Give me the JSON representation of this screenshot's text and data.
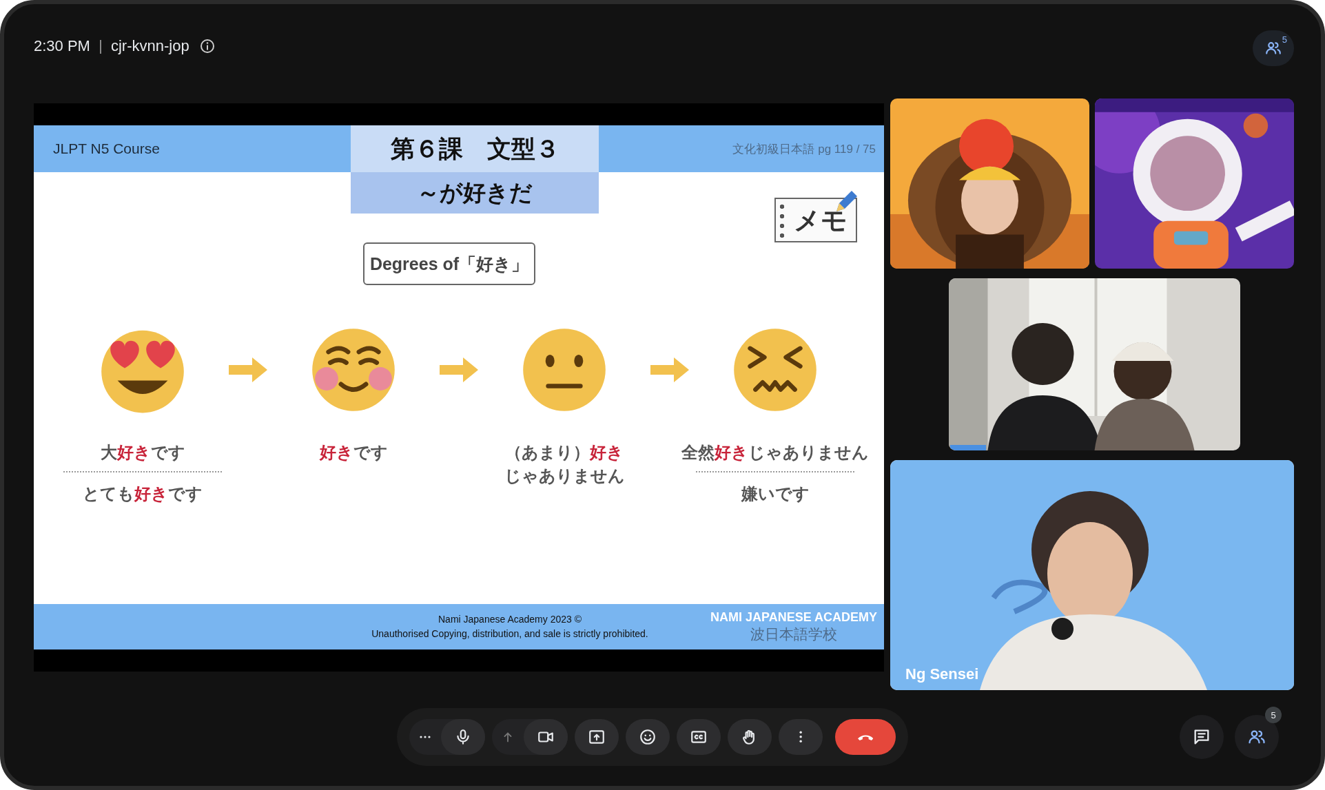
{
  "top_bar": {
    "time": "2:30 PM",
    "meeting_code": "cjr-kvnn-jop",
    "people_count": "5"
  },
  "slide": {
    "course": "JLPT N5 Course",
    "lesson_title": "第６課　文型３",
    "pattern": "～が好きだ",
    "page_ref": "文化初級日本語 pg 119 / 75",
    "memo": "メモ",
    "subtitle": "Degrees of「好き」",
    "degrees": [
      {
        "kind": "heart-eyes",
        "label": [
          "大**好き**です"
        ],
        "alt_label": "とても**好き**です"
      },
      {
        "kind": "blush",
        "label": [
          "**好き**です"
        ]
      },
      {
        "kind": "neutral",
        "label": [
          "（あまり）**好き**",
          "じゃありません"
        ]
      },
      {
        "kind": "confounded",
        "label": [
          "全然**好き**じゃありません"
        ],
        "alt_label": "嫌いです"
      }
    ],
    "footer": {
      "copyright": "Nami Japanese Academy 2023 ©",
      "notice": "Unauthorised Copying, distribution, and sale is strictly prohibited.",
      "brand": "NAMI JAPANESE ACADEMY",
      "brand_jp": "波日本語学校"
    }
  },
  "participants": [
    {
      "kind": "picture",
      "speaking": false
    },
    {
      "kind": "picture",
      "speaking": false
    },
    {
      "kind": "picture",
      "speaking": true
    },
    {
      "kind": "picture",
      "speaking": false,
      "name": "Ng Sensei"
    }
  ],
  "controls": [
    {
      "kind": "more"
    },
    {
      "kind": "mic"
    },
    {
      "kind": "caret"
    },
    {
      "kind": "camera"
    },
    {
      "kind": "present"
    },
    {
      "kind": "emoji"
    },
    {
      "kind": "captions"
    },
    {
      "kind": "hand"
    },
    {
      "kind": "more-vert"
    },
    {
      "kind": "hangup"
    }
  ],
  "side_buttons": [
    {
      "kind": "chat"
    },
    {
      "kind": "people",
      "badge": "5"
    }
  ]
}
